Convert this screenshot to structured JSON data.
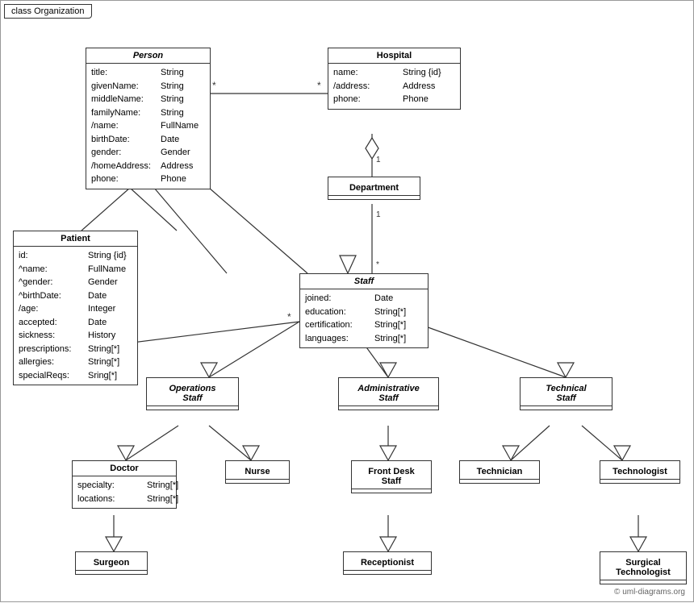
{
  "title": "class Organization",
  "classes": {
    "person": {
      "name": "Person",
      "italic": true,
      "attrs": [
        {
          "name": "title:",
          "type": "String"
        },
        {
          "name": "givenName:",
          "type": "String"
        },
        {
          "name": "middleName:",
          "type": "String"
        },
        {
          "name": "familyName:",
          "type": "String"
        },
        {
          "name": "/name:",
          "type": "FullName"
        },
        {
          "name": "birthDate:",
          "type": "Date"
        },
        {
          "name": "gender:",
          "type": "Gender"
        },
        {
          "name": "/homeAddress:",
          "type": "Address"
        },
        {
          "name": "phone:",
          "type": "Phone"
        }
      ]
    },
    "hospital": {
      "name": "Hospital",
      "italic": false,
      "attrs": [
        {
          "name": "name:",
          "type": "String {id}"
        },
        {
          "name": "/address:",
          "type": "Address"
        },
        {
          "name": "phone:",
          "type": "Phone"
        }
      ]
    },
    "patient": {
      "name": "Patient",
      "italic": false,
      "attrs": [
        {
          "name": "id:",
          "type": "String {id}"
        },
        {
          "name": "^name:",
          "type": "FullName"
        },
        {
          "name": "^gender:",
          "type": "Gender"
        },
        {
          "name": "^birthDate:",
          "type": "Date"
        },
        {
          "name": "/age:",
          "type": "Integer"
        },
        {
          "name": "accepted:",
          "type": "Date"
        },
        {
          "name": "sickness:",
          "type": "History"
        },
        {
          "name": "prescriptions:",
          "type": "String[*]"
        },
        {
          "name": "allergies:",
          "type": "String[*]"
        },
        {
          "name": "specialReqs:",
          "type": "Sring[*]"
        }
      ]
    },
    "department": {
      "name": "Department",
      "italic": false,
      "attrs": []
    },
    "staff": {
      "name": "Staff",
      "italic": true,
      "attrs": [
        {
          "name": "joined:",
          "type": "Date"
        },
        {
          "name": "education:",
          "type": "String[*]"
        },
        {
          "name": "certification:",
          "type": "String[*]"
        },
        {
          "name": "languages:",
          "type": "String[*]"
        }
      ]
    },
    "operations_staff": {
      "name": "Operations Staff",
      "italic": true
    },
    "administrative_staff": {
      "name": "Administrative Staff",
      "italic": true
    },
    "technical_staff": {
      "name": "Technical Staff",
      "italic": true
    },
    "doctor": {
      "name": "Doctor",
      "italic": false,
      "attrs": [
        {
          "name": "specialty:",
          "type": "String[*]"
        },
        {
          "name": "locations:",
          "type": "String[*]"
        }
      ]
    },
    "nurse": {
      "name": "Nurse",
      "italic": false,
      "attrs": []
    },
    "front_desk_staff": {
      "name": "Front Desk Staff",
      "italic": false,
      "attrs": []
    },
    "technician": {
      "name": "Technician",
      "italic": false,
      "attrs": []
    },
    "technologist": {
      "name": "Technologist",
      "italic": false,
      "attrs": []
    },
    "surgeon": {
      "name": "Surgeon",
      "italic": false,
      "attrs": []
    },
    "receptionist": {
      "name": "Receptionist",
      "italic": false,
      "attrs": []
    },
    "surgical_technologist": {
      "name": "Surgical Technologist",
      "italic": false,
      "attrs": []
    }
  },
  "copyright": "© uml-diagrams.org"
}
